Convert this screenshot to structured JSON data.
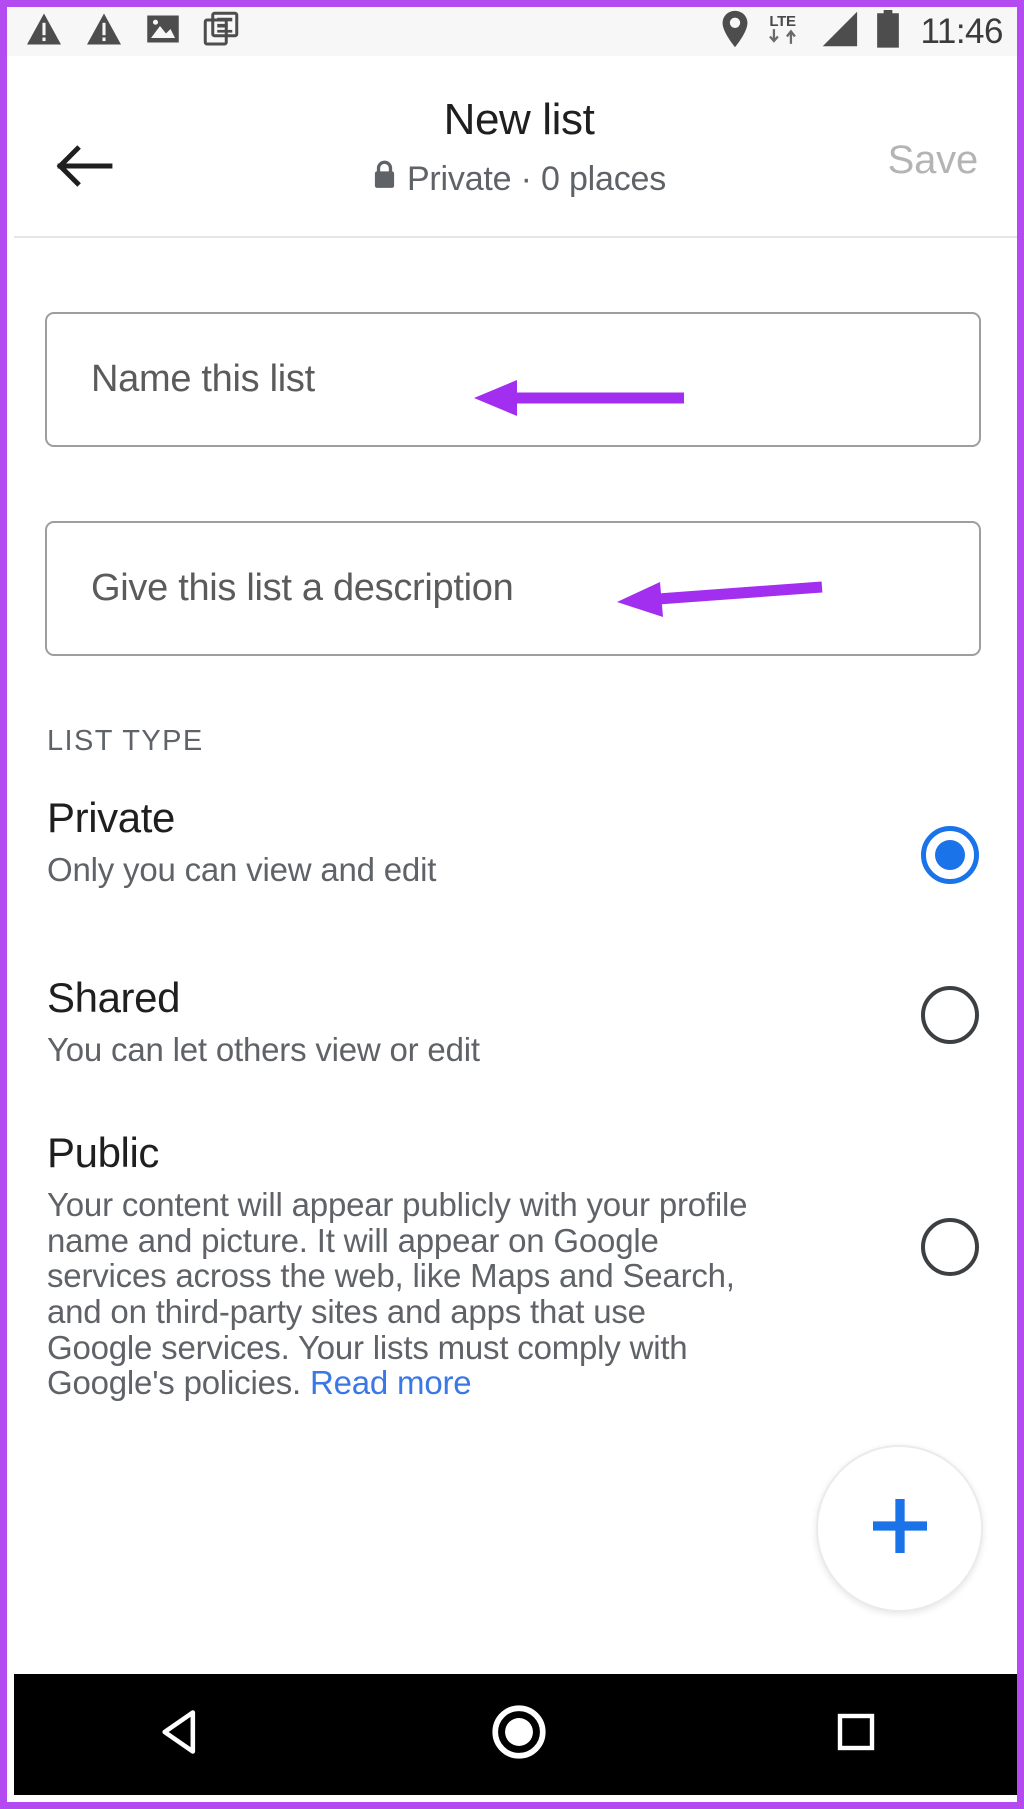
{
  "status_bar": {
    "icons": [
      "warning-icon",
      "warning-icon",
      "image-icon",
      "document-stack-icon"
    ],
    "location_icon": "location-pin-icon",
    "network_label": "LTE",
    "data_arrows": "data-transfer-icon",
    "signal_icon": "signal-bars-icon",
    "battery_icon": "battery-icon",
    "time": "11:46"
  },
  "app_bar": {
    "back_icon": "back-arrow-icon",
    "title": "New list",
    "lock_icon": "lock-icon",
    "subtitle": "Private · 0 places",
    "save_label": "Save"
  },
  "form": {
    "name_placeholder": "Name this list",
    "description_placeholder": "Give this list a description"
  },
  "list_type": {
    "section_label": "LIST TYPE",
    "options": [
      {
        "title": "Private",
        "description": "Only you can view and edit",
        "selected": true
      },
      {
        "title": "Shared",
        "description": "You can let others view or edit",
        "selected": false
      },
      {
        "title": "Public",
        "description": "Your content will appear publicly with your profile name and picture. It will appear on Google services across the web, like Maps and Search, and on third-party sites and apps that use Google services. Your lists must comply with Google's policies. ",
        "link_label": "Read more",
        "selected": false
      }
    ]
  },
  "fab": {
    "icon": "plus-icon",
    "accent_color": "#1a73e8"
  },
  "nav_bar": {
    "back_icon": "nav-back-triangle-icon",
    "home_icon": "nav-home-circle-icon",
    "recents_icon": "nav-recents-square-icon"
  },
  "annotations": {
    "color": "#a22ff0",
    "arrow_name_field": "annotation-arrow-name-field",
    "arrow_description_field": "annotation-arrow-description-field",
    "border_color": "#b44bf0"
  }
}
